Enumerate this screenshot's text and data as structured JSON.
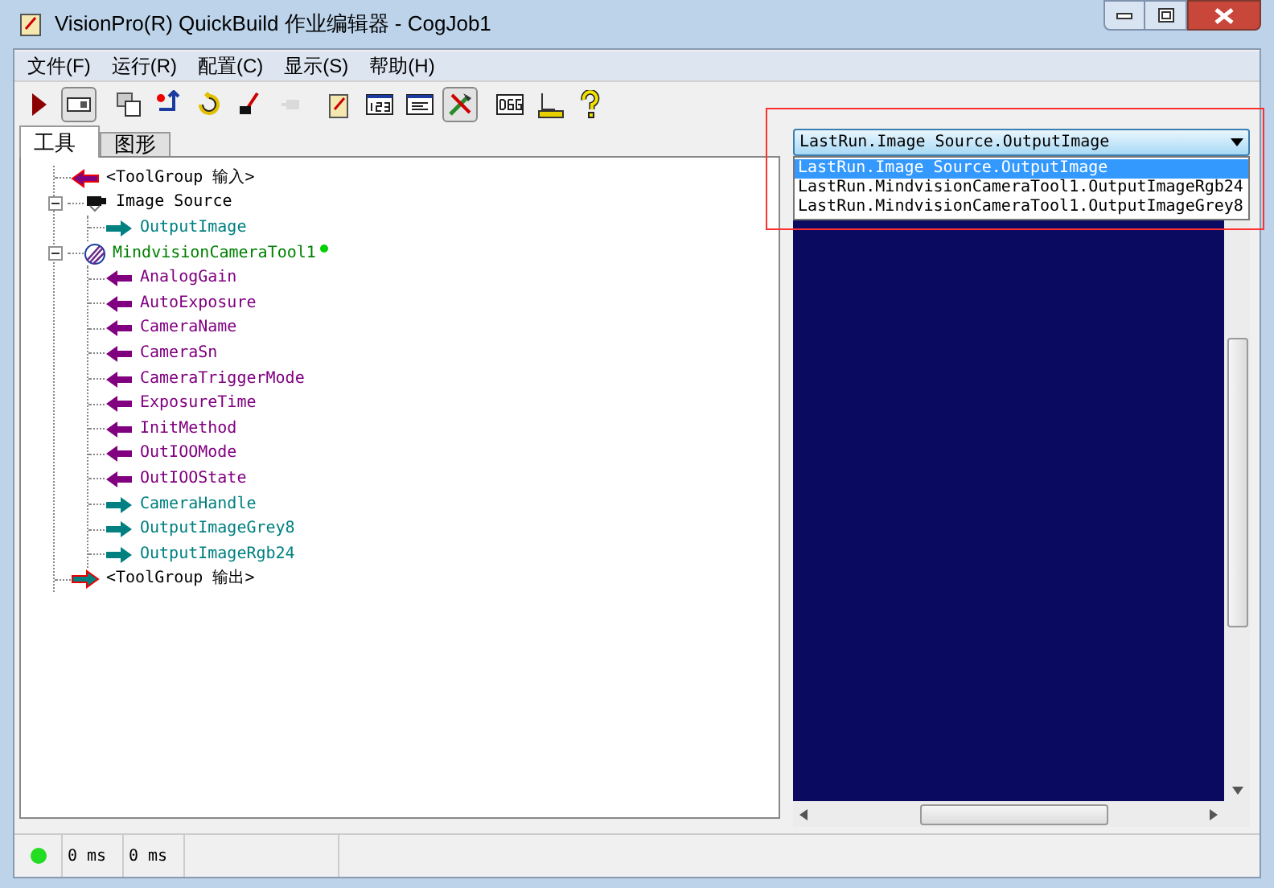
{
  "window": {
    "title": "VisionPro(R) QuickBuild 作业编辑器 - CogJob1"
  },
  "menu": [
    "文件(F)",
    "运行(R)",
    "配置(C)",
    "显示(S)",
    "帮助(H)"
  ],
  "toolbar": [
    {
      "kind": "run",
      "pressed": false,
      "disabled": false
    },
    {
      "kind": "panel",
      "pressed": true,
      "disabled": false
    },
    {
      "kind": "windows",
      "pressed": false,
      "disabled": false
    },
    {
      "kind": "reset",
      "pressed": false,
      "disabled": false
    },
    {
      "kind": "refresh",
      "pressed": false,
      "disabled": false
    },
    {
      "kind": "probe",
      "pressed": false,
      "disabled": false
    },
    {
      "kind": "plug",
      "pressed": false,
      "disabled": true
    },
    {
      "kind": "clipboard",
      "pressed": false,
      "disabled": false
    },
    {
      "kind": "numbers",
      "pressed": false,
      "disabled": false
    },
    {
      "kind": "form",
      "pressed": false,
      "disabled": false
    },
    {
      "kind": "tools",
      "pressed": true,
      "disabled": false
    },
    {
      "kind": "debug",
      "pressed": false,
      "disabled": false
    },
    {
      "kind": "ruler",
      "pressed": false,
      "disabled": false
    },
    {
      "kind": "help",
      "pressed": false,
      "disabled": false
    }
  ],
  "tabs": [
    {
      "label": "工具",
      "selected": true
    },
    {
      "label": "图形",
      "selected": false
    }
  ],
  "tree": [
    {
      "label": "<ToolGroup 输入>",
      "kind": "group_in"
    },
    {
      "label": "Image Source",
      "kind": "tool",
      "expanded": true,
      "modified": false,
      "children": [
        {
          "label": "OutputImage",
          "kind": "output"
        }
      ]
    },
    {
      "label": "MindvisionCameraTool1",
      "kind": "tool",
      "expanded": true,
      "modified": true,
      "children": [
        {
          "label": "AnalogGain",
          "kind": "input"
        },
        {
          "label": "AutoExposure",
          "kind": "input"
        },
        {
          "label": "CameraName",
          "kind": "input"
        },
        {
          "label": "CameraSn",
          "kind": "input"
        },
        {
          "label": "CameraTriggerMode",
          "kind": "input"
        },
        {
          "label": "ExposureTime",
          "kind": "input"
        },
        {
          "label": "InitMethod",
          "kind": "input"
        },
        {
          "label": "OutIOOMode",
          "kind": "input"
        },
        {
          "label": "OutIOOState",
          "kind": "input"
        },
        {
          "label": "CameraHandle",
          "kind": "output"
        },
        {
          "label": "OutputImageGrey8",
          "kind": "output"
        },
        {
          "label": "OutputImageRgb24",
          "kind": "output"
        }
      ]
    },
    {
      "label": "<ToolGroup 输出>",
      "kind": "group_out"
    }
  ],
  "image_selector": {
    "value": "LastRun.Image Source.OutputImage",
    "expanded": true,
    "options": [
      {
        "label": "LastRun.Image Source.OutputImage",
        "selected": true
      },
      {
        "label": "LastRun.MindvisionCameraTool1.OutputImageRgb24",
        "selected": false
      },
      {
        "label": "LastRun.MindvisionCameraTool1.OutputImageGrey8",
        "selected": false
      }
    ]
  },
  "status_bar": {
    "running": true,
    "cells": [
      "0 ms",
      "0 ms"
    ]
  }
}
